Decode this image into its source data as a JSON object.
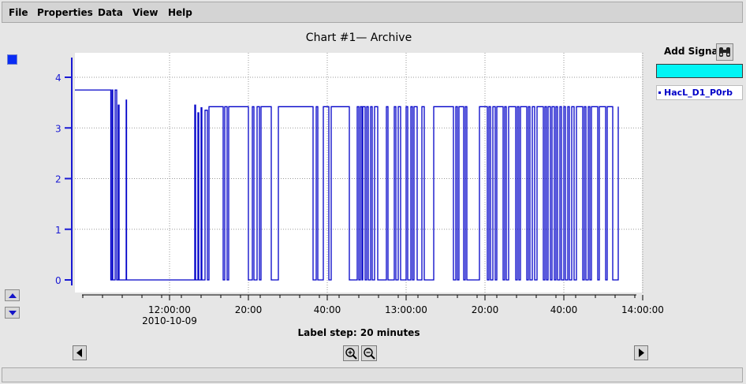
{
  "menu": {
    "items": [
      {
        "label": "File"
      },
      {
        "label": "Properties"
      },
      {
        "label": "Data"
      },
      {
        "label": "View"
      },
      {
        "label": "Help"
      }
    ]
  },
  "chart": {
    "title": "Chart #1— Archive",
    "label_step": "Label step: 20 minutes"
  },
  "signals": {
    "add_label": "Add Signal",
    "search_value": "",
    "items": [
      {
        "name": "HacL_D1_P0rb"
      }
    ]
  },
  "icons": {
    "zoom_in": "zoom-in-icon",
    "zoom_out": "zoom-out-icon",
    "scroll_left": "triangle-left-icon",
    "scroll_right": "triangle-right-icon",
    "scale_up": "triangle-up-icon",
    "scale_down": "triangle-down-icon",
    "find_signal": "binoculars-icon"
  },
  "colors": {
    "signal": "#0000c8",
    "search_bg": "#00f5f5",
    "axis": "#1a1ad4"
  },
  "chart_data": {
    "type": "line",
    "step": true,
    "title": "Chart #1— Archive",
    "xlabel": "",
    "ylabel": "",
    "ylim": [
      -0.1,
      4.5
    ],
    "yticks": [
      0,
      1,
      2,
      3,
      4
    ],
    "x_unit": "minutes after 11:38",
    "xlim": [
      0,
      143
    ],
    "xticks": [
      {
        "pos": 22,
        "label": "12:00:00",
        "sublabel": "2010-10-09"
      },
      {
        "pos": 42,
        "label": "20:00"
      },
      {
        "pos": 62,
        "label": "40:00"
      },
      {
        "pos": 82,
        "label": "13:00:00"
      },
      {
        "pos": 102,
        "label": "20:00"
      },
      {
        "pos": 122,
        "label": "40:00"
      },
      {
        "pos": 142,
        "label": "14:00:00"
      }
    ],
    "grid": true,
    "legend": "right",
    "series": [
      {
        "name": "HacL_D1_P0rb",
        "points": [
          [
            0,
            3.75
          ],
          [
            9.1,
            3.75
          ],
          [
            9.1,
            0
          ],
          [
            9.4,
            0
          ],
          [
            9.4,
            3.75
          ],
          [
            9.6,
            3.75
          ],
          [
            9.6,
            0
          ],
          [
            10.2,
            0
          ],
          [
            10.2,
            3.75
          ],
          [
            10.6,
            3.75
          ],
          [
            10.6,
            0
          ],
          [
            11.0,
            0
          ],
          [
            11.0,
            3.45
          ],
          [
            11.2,
            3.45
          ],
          [
            11.2,
            0
          ],
          [
            13.0,
            0
          ],
          [
            13.0,
            3.55
          ],
          [
            13.1,
            3.55
          ],
          [
            13.1,
            0
          ],
          [
            30.4,
            0
          ],
          [
            30.4,
            3.45
          ],
          [
            30.6,
            3.45
          ],
          [
            30.6,
            0
          ],
          [
            31.2,
            0
          ],
          [
            31.2,
            3.3
          ],
          [
            31.4,
            3.3
          ],
          [
            31.4,
            0
          ],
          [
            32.0,
            0
          ],
          [
            32.0,
            3.4
          ],
          [
            32.2,
            3.4
          ],
          [
            32.2,
            0
          ],
          [
            33.0,
            0
          ],
          [
            33.0,
            3.35
          ],
          [
            33.6,
            3.35
          ],
          [
            33.6,
            0
          ],
          [
            34.0,
            0
          ],
          [
            34.0,
            3.42
          ],
          [
            37.6,
            3.42
          ],
          [
            37.6,
            0
          ],
          [
            38.0,
            0
          ],
          [
            38.0,
            3.42
          ],
          [
            38.6,
            3.42
          ],
          [
            38.6,
            0
          ],
          [
            39.0,
            0
          ],
          [
            39.0,
            3.42
          ],
          [
            44.0,
            3.42
          ],
          [
            44.0,
            0
          ],
          [
            45.0,
            0
          ],
          [
            45.0,
            3.42
          ],
          [
            45.4,
            3.42
          ],
          [
            45.4,
            0
          ],
          [
            46.2,
            0
          ],
          [
            46.2,
            3.42
          ],
          [
            46.8,
            3.42
          ],
          [
            46.8,
            0
          ],
          [
            47.2,
            0
          ],
          [
            47.2,
            3.42
          ],
          [
            49.8,
            3.42
          ],
          [
            49.8,
            0
          ],
          [
            51.6,
            0
          ],
          [
            51.6,
            3.42
          ],
          [
            60.4,
            3.42
          ],
          [
            60.4,
            0
          ],
          [
            61.2,
            0
          ],
          [
            61.2,
            3.42
          ],
          [
            61.6,
            3.42
          ],
          [
            61.6,
            0
          ],
          [
            63.0,
            0
          ],
          [
            63.0,
            3.42
          ],
          [
            64.4,
            3.42
          ],
          [
            64.4,
            0
          ],
          [
            65.0,
            0
          ],
          [
            65.0,
            3.42
          ],
          [
            69.6,
            3.42
          ],
          [
            69.6,
            0
          ],
          [
            71.6,
            0
          ],
          [
            71.6,
            3.42
          ],
          [
            72.0,
            3.42
          ],
          [
            72.0,
            0
          ],
          [
            72.4,
            0
          ],
          [
            72.4,
            3.42
          ],
          [
            72.8,
            3.42
          ],
          [
            72.8,
            0
          ],
          [
            73.0,
            0
          ],
          [
            73.0,
            3.42
          ],
          [
            73.6,
            3.42
          ],
          [
            73.6,
            0
          ],
          [
            74.0,
            0
          ],
          [
            74.0,
            3.42
          ],
          [
            74.4,
            3.42
          ],
          [
            74.4,
            0
          ],
          [
            75.0,
            0
          ],
          [
            75.0,
            3.42
          ],
          [
            75.4,
            3.42
          ],
          [
            75.4,
            0
          ],
          [
            76.0,
            0
          ],
          [
            76.0,
            3.42
          ],
          [
            76.8,
            3.42
          ],
          [
            76.8,
            0
          ],
          [
            79.0,
            0
          ],
          [
            79.0,
            3.42
          ],
          [
            79.4,
            3.42
          ],
          [
            79.4,
            0
          ],
          [
            81.0,
            0
          ],
          [
            81.0,
            3.42
          ],
          [
            81.4,
            3.42
          ],
          [
            81.4,
            0
          ],
          [
            82.0,
            0
          ],
          [
            82.0,
            3.42
          ],
          [
            82.6,
            3.42
          ],
          [
            82.6,
            0
          ],
          [
            84.0,
            0
          ],
          [
            84.0,
            3.42
          ],
          [
            84.4,
            3.42
          ],
          [
            84.4,
            0
          ],
          [
            85.2,
            0
          ],
          [
            85.2,
            3.42
          ],
          [
            85.6,
            3.42
          ],
          [
            85.6,
            0
          ],
          [
            86.0,
            0
          ],
          [
            86.0,
            3.42
          ],
          [
            86.8,
            3.42
          ],
          [
            86.8,
            0
          ],
          [
            88.0,
            0
          ],
          [
            88.0,
            3.42
          ],
          [
            88.6,
            3.42
          ],
          [
            88.6,
            0
          ],
          [
            91.0,
            0
          ],
          [
            91.0,
            3.42
          ],
          [
            96.0,
            3.42
          ],
          [
            96.0,
            0
          ],
          [
            96.6,
            0
          ],
          [
            96.6,
            3.42
          ],
          [
            97.0,
            3.42
          ],
          [
            97.0,
            0
          ],
          [
            97.4,
            0
          ],
          [
            97.4,
            3.42
          ],
          [
            98.6,
            3.42
          ],
          [
            98.6,
            0
          ],
          [
            99.0,
            0
          ],
          [
            99.0,
            3.42
          ],
          [
            99.4,
            3.42
          ],
          [
            99.4,
            0
          ],
          [
            102.6,
            0
          ],
          [
            102.6,
            3.42
          ],
          [
            104.6,
            3.42
          ],
          [
            104.6,
            0
          ],
          [
            105.0,
            0
          ],
          [
            105.0,
            3.42
          ],
          [
            105.4,
            3.42
          ],
          [
            105.4,
            0
          ],
          [
            106.0,
            0
          ],
          [
            106.0,
            3.42
          ],
          [
            106.6,
            3.42
          ],
          [
            106.6,
            0
          ],
          [
            107.0,
            0
          ],
          [
            107.0,
            3.42
          ],
          [
            108.6,
            3.42
          ],
          [
            108.6,
            0
          ],
          [
            109.0,
            0
          ],
          [
            109.0,
            3.42
          ],
          [
            109.4,
            3.42
          ],
          [
            109.4,
            0
          ],
          [
            110.0,
            0
          ],
          [
            110.0,
            3.42
          ],
          [
            111.8,
            3.42
          ],
          [
            111.8,
            0
          ],
          [
            112.2,
            0
          ],
          [
            112.2,
            3.42
          ],
          [
            112.6,
            3.42
          ],
          [
            112.6,
            0
          ],
          [
            113.0,
            0
          ],
          [
            113.0,
            3.42
          ],
          [
            114.6,
            3.42
          ],
          [
            114.6,
            0
          ],
          [
            115.0,
            0
          ],
          [
            115.0,
            3.42
          ],
          [
            115.4,
            3.42
          ],
          [
            115.4,
            0
          ],
          [
            116.0,
            0
          ],
          [
            116.0,
            3.42
          ],
          [
            116.6,
            3.42
          ],
          [
            116.6,
            0
          ],
          [
            117.2,
            0
          ],
          [
            117.2,
            3.42
          ],
          [
            118.8,
            3.42
          ],
          [
            118.8,
            0
          ],
          [
            119.2,
            0
          ],
          [
            119.2,
            3.42
          ],
          [
            119.6,
            3.42
          ],
          [
            119.6,
            0
          ],
          [
            120.0,
            0
          ],
          [
            120.0,
            3.42
          ],
          [
            120.6,
            3.42
          ],
          [
            120.6,
            0
          ],
          [
            121.0,
            0
          ],
          [
            121.0,
            3.42
          ],
          [
            121.6,
            3.42
          ],
          [
            121.6,
            0
          ],
          [
            122.0,
            0
          ],
          [
            122.0,
            3.42
          ],
          [
            122.4,
            3.42
          ],
          [
            122.4,
            0
          ],
          [
            123.0,
            0
          ],
          [
            123.0,
            3.42
          ],
          [
            123.4,
            3.42
          ],
          [
            123.4,
            0
          ],
          [
            124.0,
            0
          ],
          [
            124.0,
            3.42
          ],
          [
            124.4,
            3.42
          ],
          [
            124.4,
            0
          ],
          [
            125.0,
            0
          ],
          [
            125.0,
            3.42
          ],
          [
            125.4,
            3.42
          ],
          [
            125.4,
            0
          ],
          [
            126.0,
            0
          ],
          [
            126.0,
            3.42
          ],
          [
            126.6,
            3.42
          ],
          [
            126.6,
            0
          ],
          [
            127.2,
            0
          ],
          [
            127.2,
            3.42
          ],
          [
            128.8,
            3.42
          ],
          [
            128.8,
            0
          ],
          [
            129.2,
            0
          ],
          [
            129.2,
            3.42
          ],
          [
            129.6,
            3.42
          ],
          [
            129.6,
            0
          ],
          [
            130.2,
            0
          ],
          [
            130.2,
            3.42
          ],
          [
            130.6,
            3.42
          ],
          [
            130.6,
            0
          ],
          [
            131.0,
            0
          ],
          [
            131.0,
            3.42
          ],
          [
            132.6,
            3.42
          ],
          [
            132.6,
            0
          ],
          [
            133.0,
            0
          ],
          [
            133.0,
            3.42
          ],
          [
            134.6,
            3.42
          ],
          [
            134.6,
            0
          ],
          [
            135.0,
            0
          ],
          [
            135.0,
            3.42
          ],
          [
            136.4,
            3.42
          ],
          [
            136.4,
            0
          ],
          [
            138.0,
            0
          ],
          [
            138.0,
            3.42
          ],
          [
            138.4,
            3.42
          ],
          [
            138.4,
            0
          ],
          [
            139.0,
            0
          ],
          [
            139.0,
            3.42
          ],
          [
            139.6,
            3.42
          ],
          [
            139.6,
            0
          ],
          [
            140.0,
            0
          ],
          [
            140.0,
            3.42
          ],
          [
            140.6,
            3.42
          ],
          [
            140.6,
            0
          ],
          [
            141.0,
            0
          ],
          [
            141.0,
            3.42
          ],
          [
            141.4,
            3.42
          ],
          [
            141.4,
            0
          ],
          [
            142.0,
            0
          ],
          [
            142.0,
            3.42
          ],
          [
            142.6,
            3.42
          ],
          [
            142.6,
            0
          ],
          [
            143.0,
            0
          ],
          [
            143.0,
            3.42
          ],
          [
            143.4,
            3.42
          ],
          [
            143.4,
            0
          ],
          [
            144.0,
            0
          ],
          [
            144.0,
            3.42
          ],
          [
            144.8,
            3.42
          ],
          [
            144.8,
            0
          ],
          [
            146.0,
            0
          ]
        ]
      }
    ]
  }
}
